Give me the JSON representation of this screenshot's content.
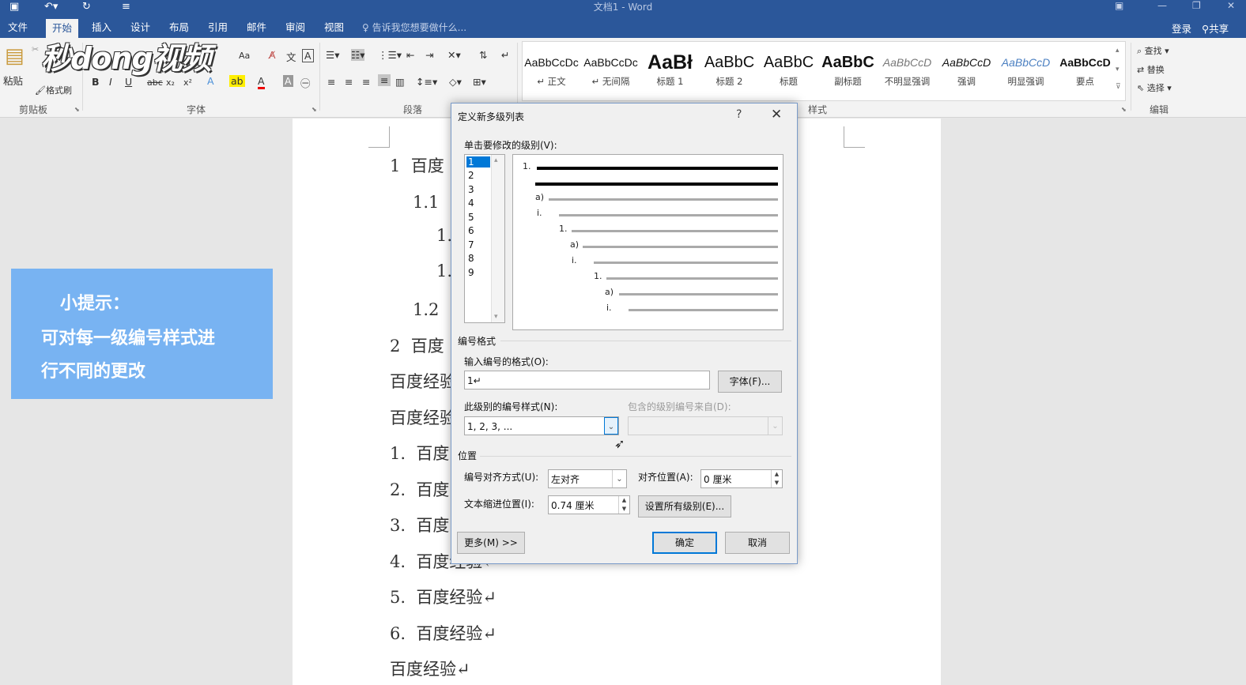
{
  "window": {
    "title": "文档1 - Word"
  },
  "tabs": [
    "文件",
    "开始",
    "插入",
    "设计",
    "布局",
    "引用",
    "邮件",
    "审阅",
    "视图"
  ],
  "tell_me": "告诉我您想要做什么...",
  "account": {
    "login": "登录",
    "share": "共享"
  },
  "ribbon": {
    "clipboard": {
      "label": "剪贴板",
      "paste": "粘贴",
      "format_painter": "格式刷"
    },
    "font": {
      "label": "字体",
      "size_menu": "Aa",
      "bold": "B",
      "italic": "I",
      "underline": "U",
      "strike": "abc",
      "sub": "x₂",
      "sup": "x²",
      "font_color_a": "A"
    },
    "paragraph": {
      "label": "段落"
    },
    "styles": {
      "label": "样式",
      "items": [
        {
          "preview": "AaBbCcDc",
          "name": "↵ 正文"
        },
        {
          "preview": "AaBbCcDc",
          "name": "↵ 无间隔"
        },
        {
          "preview": "AaBł",
          "name": "标题 1"
        },
        {
          "preview": "AaBbC",
          "name": "标题 2"
        },
        {
          "preview": "AaBbC",
          "name": "标题"
        },
        {
          "preview": "AaBbC",
          "name": "副标题"
        },
        {
          "preview": "AaBbCcD",
          "name": "不明显强调"
        },
        {
          "preview": "AaBbCcD",
          "name": "强调"
        },
        {
          "preview": "AaBbCcD",
          "name": "明显强调"
        },
        {
          "preview": "AaBbCcD",
          "name": "要点"
        }
      ]
    },
    "editing": {
      "label": "编辑",
      "find": "查找",
      "replace": "替换",
      "select": "选择"
    }
  },
  "watermark": "秒dong视频",
  "tip": {
    "line1": "小提示：",
    "line2": "可对每一级编号样式进",
    "line3": "行不同的更改"
  },
  "document": {
    "lines": [
      {
        "num": "1",
        "text": "百度"
      },
      {
        "num": "1.1",
        "text": "百"
      },
      {
        "num": "1.",
        "text": ""
      },
      {
        "num": "1.",
        "text": ""
      },
      {
        "num": "1.2",
        "text": "百"
      },
      {
        "num": "2",
        "text": "百度"
      },
      {
        "num": "",
        "text": "百度经验"
      },
      {
        "num": "",
        "text": "百度经验"
      },
      {
        "num": "1.",
        "text": "百度"
      },
      {
        "num": "2.",
        "text": "百度"
      },
      {
        "num": "3.",
        "text": "百度"
      },
      {
        "num": "4.",
        "text": "百度经验↵"
      },
      {
        "num": "5.",
        "text": "百度经验↵"
      },
      {
        "num": "6.",
        "text": "百度经验↵"
      },
      {
        "num": "",
        "text": "百度经验↵"
      }
    ]
  },
  "dialog": {
    "title": "定义新多级列表",
    "help": "?",
    "close": "✕",
    "level_label": "单击要修改的级别(V):",
    "levels": [
      "1",
      "2",
      "3",
      "4",
      "5",
      "6",
      "7",
      "8",
      "9"
    ],
    "selected_level": "1",
    "preview_labels": [
      "1.",
      "a)",
      "i.",
      "1.",
      "a)",
      "i.",
      "1.",
      "a)",
      "i."
    ],
    "number_format_section": "编号格式",
    "enter_format_label": "输入编号的格式(O):",
    "enter_format_value": "1↵",
    "font_button": "字体(F)...",
    "number_style_label": "此级别的编号样式(N):",
    "number_style_value": "1, 2, 3, ...",
    "include_level_label": "包含的级别编号来自(D):",
    "include_level_value": "",
    "position_section": "位置",
    "alignment_label": "编号对齐方式(U):",
    "alignment_value": "左对齐",
    "aligned_at_label": "对齐位置(A):",
    "aligned_at_value": "0 厘米",
    "indent_label": "文本缩进位置(I):",
    "indent_value": "0.74 厘米",
    "set_all_button": "设置所有级别(E)...",
    "more_button": "更多(M) >>",
    "ok_button": "确定",
    "cancel_button": "取消"
  }
}
